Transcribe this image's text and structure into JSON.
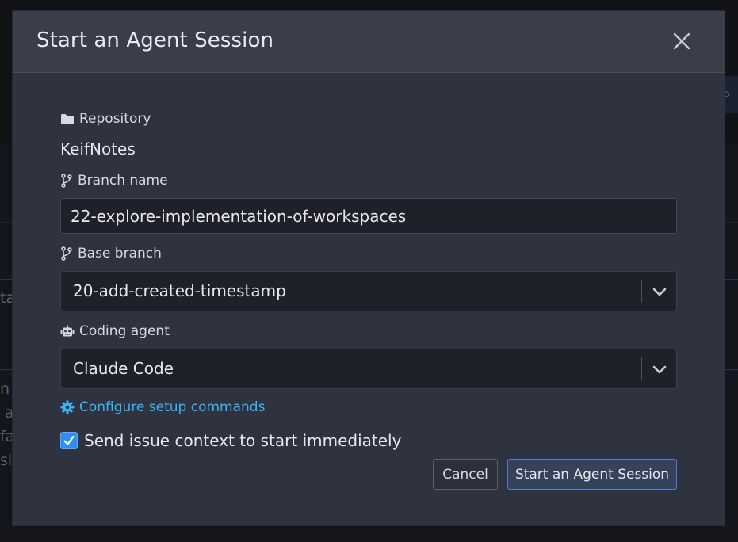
{
  "background": {
    "fragments": [
      "ta",
      "n l",
      "a",
      "fa",
      "si"
    ]
  },
  "modal": {
    "title": "Start an Agent Session",
    "close_icon": "close-icon"
  },
  "repository": {
    "label": "Repository",
    "icon": "folder-icon",
    "value": "KeifNotes"
  },
  "branch_name": {
    "label": "Branch name",
    "icon": "git-branch-icon",
    "value": "22-explore-implementation-of-workspaces"
  },
  "base_branch": {
    "label": "Base branch",
    "icon": "git-branch-icon",
    "value": "20-add-created-timestamp"
  },
  "coding_agent": {
    "label": "Coding agent",
    "icon": "robot-icon",
    "value": "Claude Code"
  },
  "setup": {
    "link": "Configure setup commands",
    "icon": "gear-icon"
  },
  "send_context": {
    "label": "Send issue context to start immediately",
    "checked": true
  },
  "buttons": {
    "cancel": "Cancel",
    "submit": "Start an Agent Session"
  },
  "colors": {
    "accent": "#3ab4f2",
    "checkbox": "#2f8ef0",
    "primary_border": "#4f7ed8"
  }
}
